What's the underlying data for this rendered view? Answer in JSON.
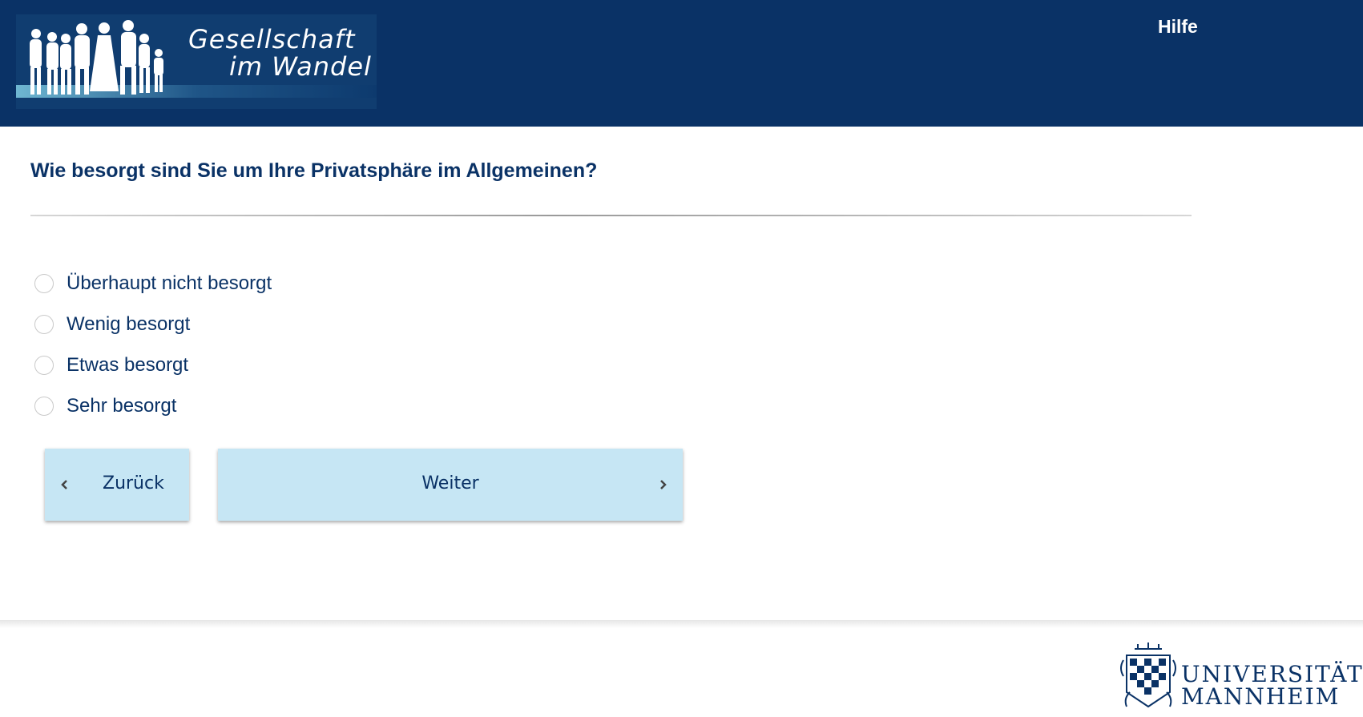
{
  "header": {
    "logo_line1": "Gesellschaft",
    "logo_line2": "im Wandel",
    "help_label": "Hilfe"
  },
  "question": {
    "text": "Wie besorgt sind Sie um Ihre Privatsphäre im Allgemeinen?",
    "options": [
      {
        "label": "Überhaupt nicht besorgt",
        "selected": false
      },
      {
        "label": "Wenig besorgt",
        "selected": false
      },
      {
        "label": "Etwas besorgt",
        "selected": false
      },
      {
        "label": "Sehr besorgt",
        "selected": false
      }
    ]
  },
  "navigation": {
    "back_label": "Zurück",
    "next_label": "Weiter"
  },
  "footer": {
    "university_line1": "UNIVERSITÄT",
    "university_line2": "MANNHEIM"
  },
  "colors": {
    "header_bg": "#0a3266",
    "text": "#0a3266",
    "button_bg": "#c6e6f4"
  }
}
